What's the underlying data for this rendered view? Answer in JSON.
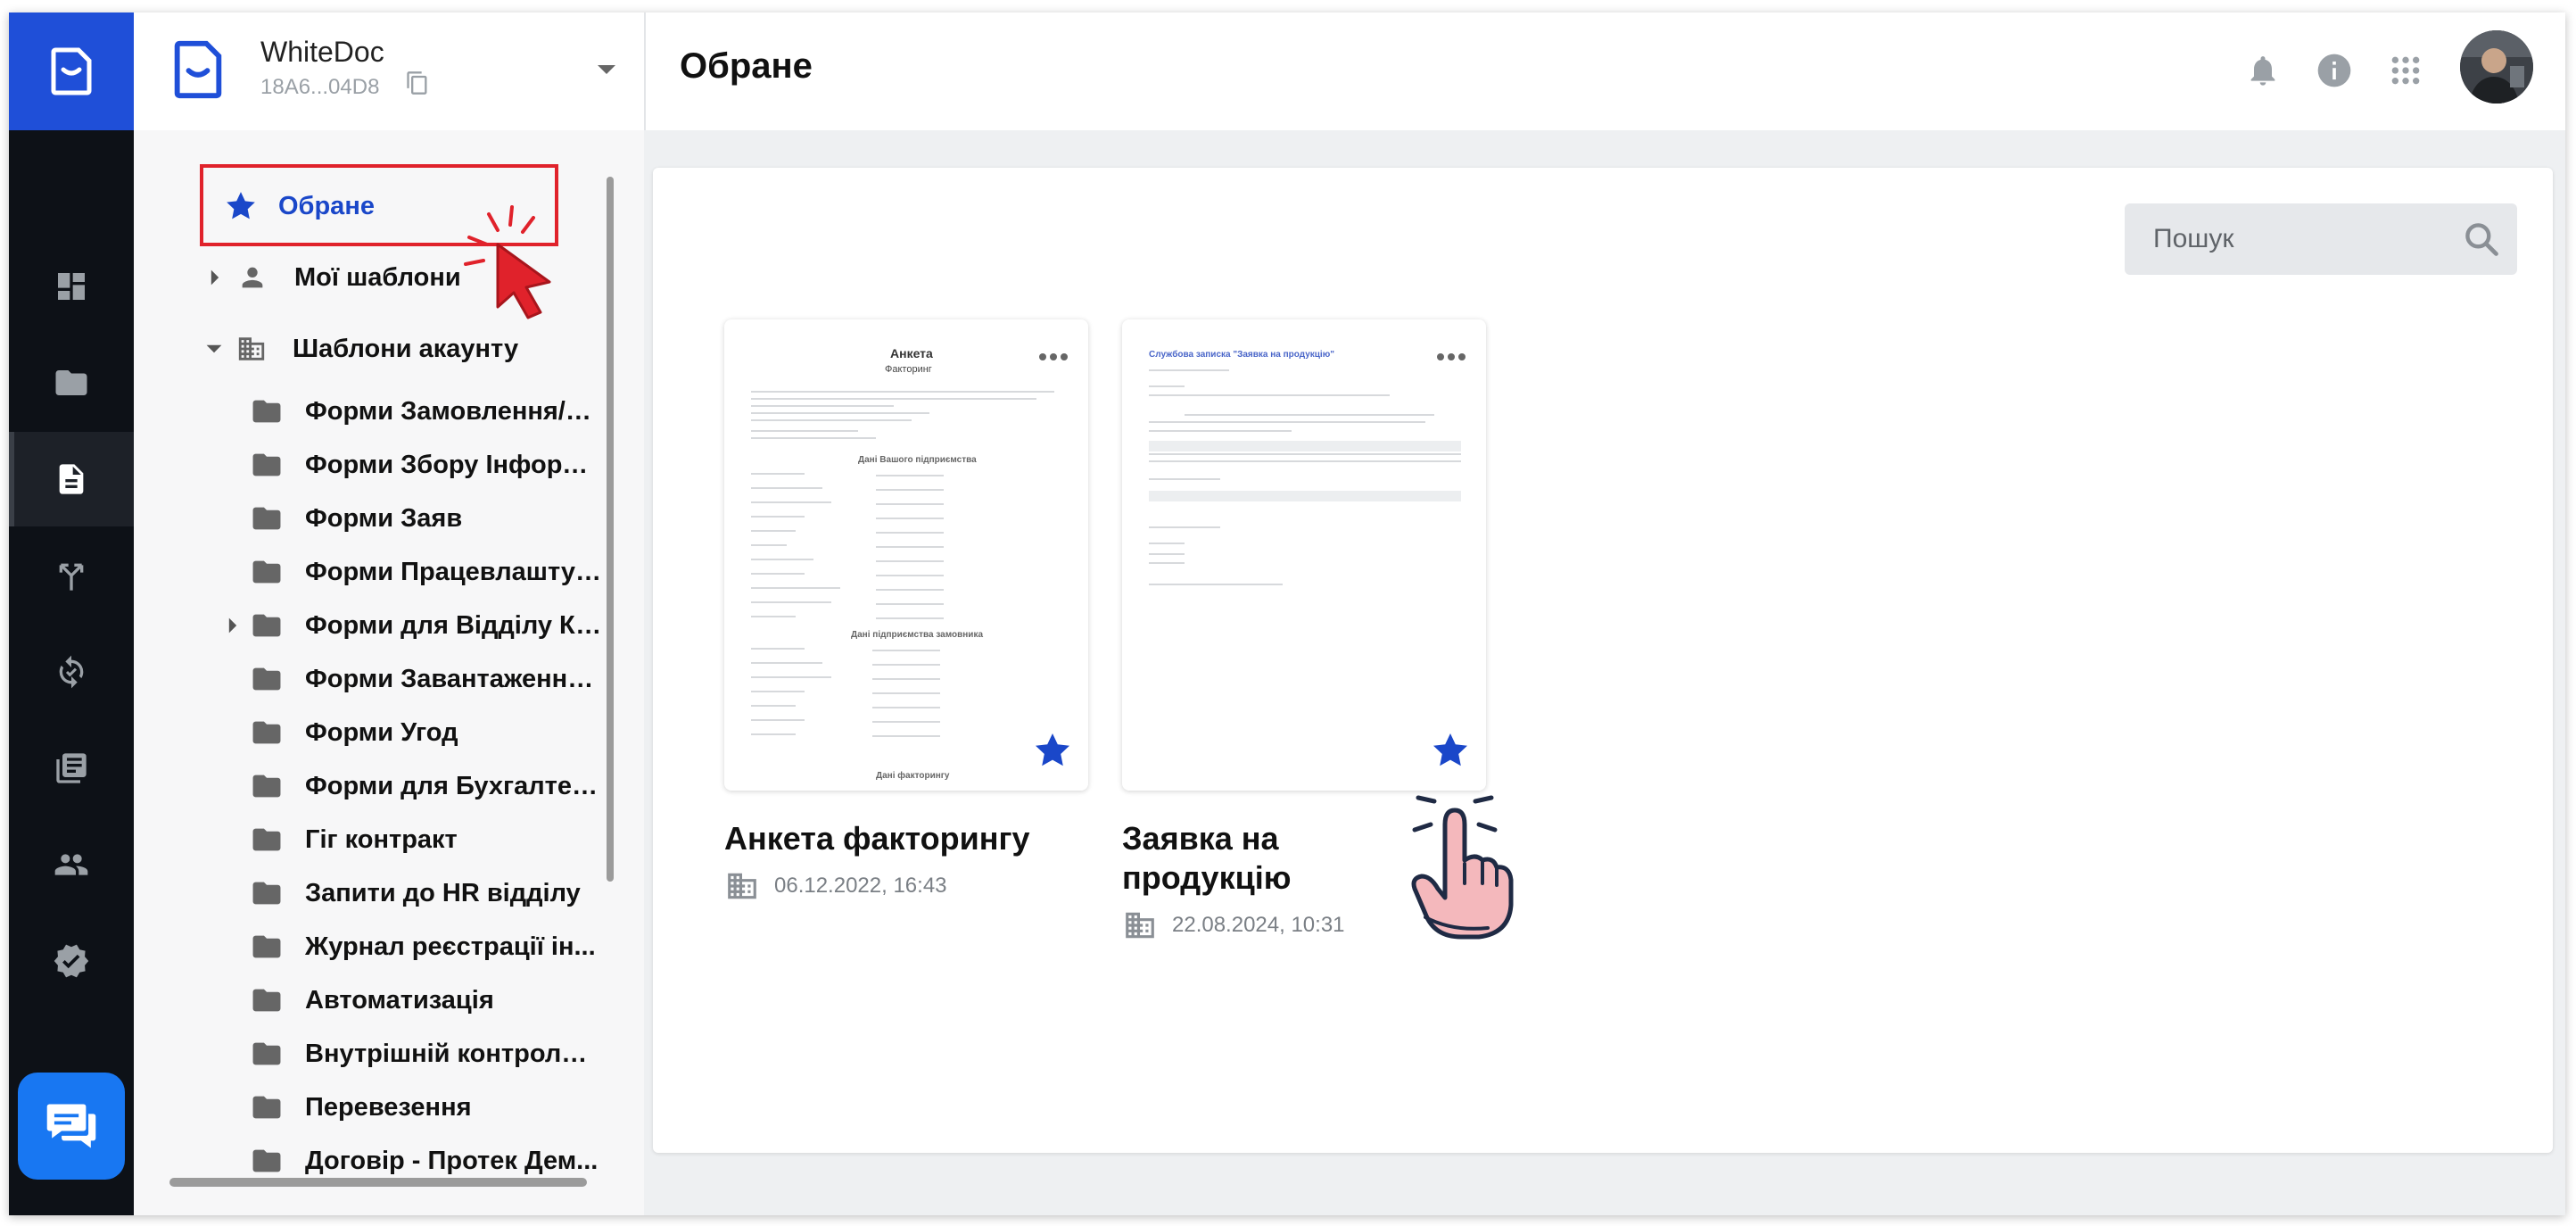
{
  "header": {
    "workspace_name": "WhiteDoc",
    "workspace_id": "18A6...04D8",
    "page_title": "Обране"
  },
  "sidebar": {
    "favorites_label": "Обране",
    "my_templates_label": "Мої шаблони",
    "account_templates_label": "Шаблони акаунту",
    "folders": [
      "Форми Замовлення/Анк...",
      "Форми Збору Інформац...",
      "Форми Заяв",
      "Форми Працевлаштуван...",
      "Форми для Відділу Ка...",
      "Форми Завантаження Ф...",
      "Форми Угод",
      "Форми для Бухгалтері...",
      "Гіг контракт",
      "Запити до HR відділу",
      "Журнал реєстрації ін...",
      "Автоматизація",
      "Внутрішній контроль/...",
      "Перевезення",
      "Договір - Протек Дем..."
    ]
  },
  "search": {
    "placeholder": "Пошук"
  },
  "cards": [
    {
      "title": "Анкета факторингу",
      "date": "06.12.2022, 16:43",
      "preview_title": "Анкета",
      "preview_subtitle": "Факторинг",
      "preview_section_1": "Дані Вашого підприємства",
      "preview_section_2": "Дані підприємства замовника",
      "preview_section_3": "Дані факторингу"
    },
    {
      "title": "Заявка на продукцію",
      "date": "22.08.2024, 10:31",
      "preview_title": "Службова записка \"Заявка на продукцію\""
    }
  ],
  "icons": {
    "logo": "whitedoc-logo-icon",
    "rail": [
      "dashboard-icon",
      "folder-icon",
      "document-icon",
      "workflow-icon",
      "sync-icon",
      "library-icon",
      "users-icon",
      "verified-icon"
    ],
    "chat": "chat-icon",
    "header": [
      "bell-icon",
      "info-icon",
      "apps-grid-icon"
    ]
  },
  "colors": {
    "brand": "#1f4fd8",
    "rail_bg": "#0d1117",
    "star": "#1a47c9",
    "highlight_box": "#e0222b",
    "chat_button": "#1877f2"
  }
}
